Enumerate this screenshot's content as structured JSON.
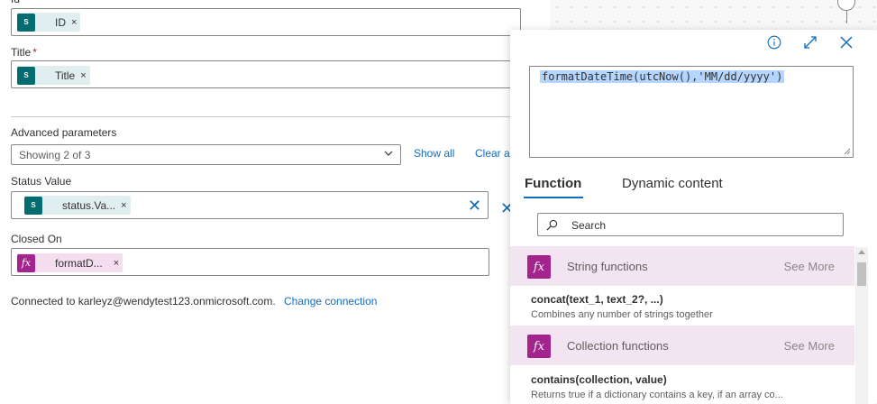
{
  "form": {
    "id_label": "Id",
    "id_token": "ID",
    "title_label": "Title",
    "title_required": "*",
    "title_token": "Title",
    "advanced_label": "Advanced parameters",
    "advanced_value": "Showing 2 of 3",
    "show_all": "Show all",
    "clear_all": "Clear a",
    "status_label": "Status Value",
    "status_token": "status.Va...",
    "closed_label": "Closed On",
    "closed_token": "formatD...",
    "connected_text": "Connected to karleyz@wendytest123.onmicrosoft.com.",
    "change_connection": "Change connection",
    "token_close": "×",
    "clear_x": "✕"
  },
  "icons": {
    "sharepoint": "sharepoint-icon",
    "function": "fx-icon",
    "info": "info-icon",
    "expand": "expand-icon",
    "close": "close-icon",
    "search": "search-icon"
  },
  "popup": {
    "expression": "formatDateTime(utcNow(),'MM/dd/yyyy')",
    "tabs": [
      "Function",
      "Dynamic content"
    ],
    "search_placeholder": "Search",
    "categories": [
      {
        "title": "String functions",
        "more": "See More",
        "function": {
          "signature": "concat(text_1, text_2?, ...)",
          "description": "Combines any number of strings together"
        }
      },
      {
        "title": "Collection functions",
        "more": "See More",
        "function": {
          "signature": "contains(collection, value)",
          "description": "Returns true if a dictionary contains a key, if an array co..."
        }
      }
    ]
  },
  "colors": {
    "accent": "#0f6cbd",
    "sharepoint": "#036c70",
    "function": "#a4248d",
    "category_bg": "#f3e4f2"
  }
}
